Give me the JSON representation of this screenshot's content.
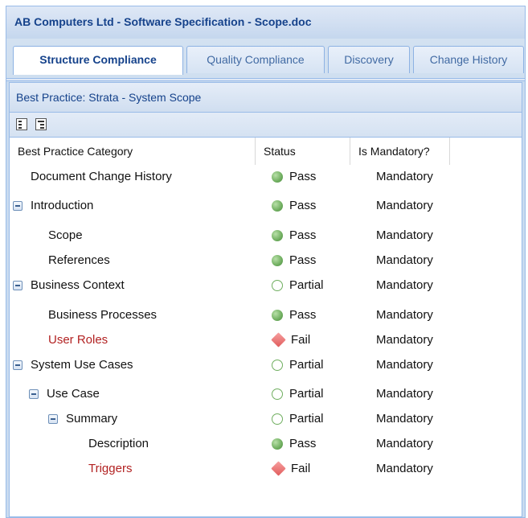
{
  "window": {
    "title": "AB Computers Ltd - Software Specification - Scope.doc"
  },
  "tabs": [
    {
      "label": "Structure Compliance",
      "active": true
    },
    {
      "label": "Quality Compliance",
      "active": false
    },
    {
      "label": "Discovery",
      "active": false
    },
    {
      "label": "Change History",
      "active": false
    }
  ],
  "panel": {
    "title": "Best Practice: Strata - System Scope"
  },
  "toolbar": {
    "buttons": [
      "collapse-all-icon",
      "expand-all-icon"
    ]
  },
  "grid": {
    "columns": [
      "Best Practice Category",
      "Status",
      "Is Mandatory?"
    ],
    "rows": [
      {
        "label": "Document Change History",
        "level": 0,
        "expandable": false,
        "status": "Pass",
        "mandatory": "Mandatory"
      },
      {
        "label": "Introduction",
        "level": 0,
        "expandable": true,
        "status": "Pass",
        "mandatory": "Mandatory"
      },
      {
        "label": "Scope",
        "level": 1,
        "expandable": false,
        "status": "Pass",
        "mandatory": "Mandatory"
      },
      {
        "label": "References",
        "level": 1,
        "expandable": false,
        "status": "Pass",
        "mandatory": "Mandatory"
      },
      {
        "label": "Business Context",
        "level": 0,
        "expandable": true,
        "status": "Partial",
        "mandatory": "Mandatory"
      },
      {
        "label": "Business Processes",
        "level": 1,
        "expandable": false,
        "status": "Pass",
        "mandatory": "Mandatory"
      },
      {
        "label": "User Roles",
        "level": 1,
        "expandable": false,
        "status": "Fail",
        "mandatory": "Mandatory"
      },
      {
        "label": "System Use Cases",
        "level": 0,
        "expandable": true,
        "status": "Partial",
        "mandatory": "Mandatory"
      },
      {
        "label": "Use Case",
        "level": 1,
        "expandable": true,
        "status": "Partial",
        "mandatory": "Mandatory"
      },
      {
        "label": "Summary",
        "level": 2,
        "expandable": true,
        "status": "Partial",
        "mandatory": "Mandatory"
      },
      {
        "label": "Description",
        "level": 3,
        "expandable": false,
        "status": "Pass",
        "mandatory": "Mandatory"
      },
      {
        "label": "Triggers",
        "level": 3,
        "expandable": false,
        "status": "Fail",
        "mandatory": "Mandatory"
      }
    ]
  },
  "colors": {
    "title_text": "#15428b",
    "pass": "#6fae5f",
    "partial": "#6fae5f",
    "fail": "#e05b5b",
    "fail_text": "#b22222"
  }
}
